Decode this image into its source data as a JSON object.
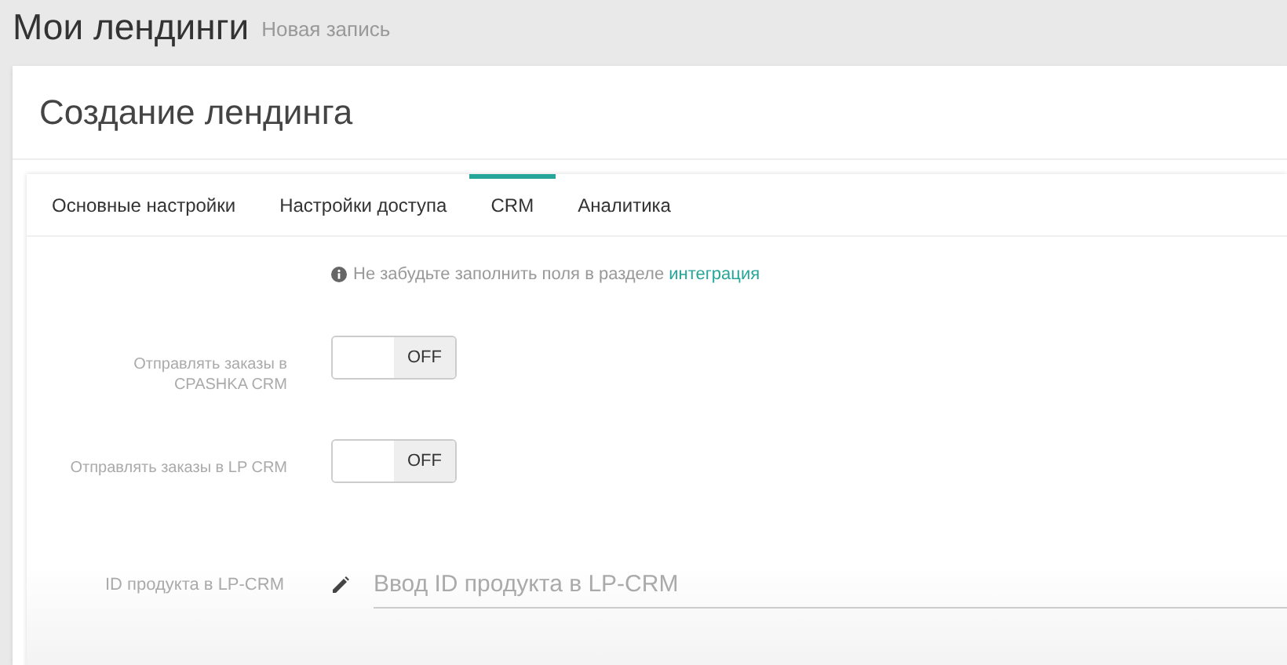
{
  "header": {
    "title": "Мои лендинги",
    "subtitle": "Новая запись"
  },
  "card": {
    "title": "Создание лендинга"
  },
  "tabs": [
    {
      "label": "Основные настройки",
      "selected": false
    },
    {
      "label": "Настройки доступа",
      "selected": false
    },
    {
      "label": "CRM",
      "selected": true
    },
    {
      "label": "Аналитика",
      "selected": false
    }
  ],
  "notice": {
    "text": "Не забудьте заполнить поля в разделе",
    "link": "интеграция"
  },
  "toggles": [
    {
      "label": "Отправлять заказы в CPASHKA CRM",
      "on": false,
      "state_label": "OFF"
    },
    {
      "label": "Отправлять заказы в LP CRM",
      "on": false,
      "state_label": "OFF"
    }
  ],
  "product_id": {
    "label": "ID продукта в LP-CRM",
    "placeholder": "Ввод ID продукта в LP-CRM"
  }
}
